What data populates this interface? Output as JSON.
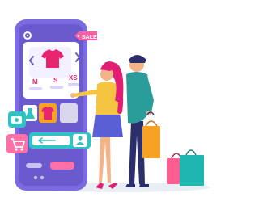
{
  "illustration": {
    "sale_tag_text": "SALE",
    "sizes": [
      "M",
      "S",
      "XS"
    ],
    "selected_size": "S",
    "colors": {
      "phone_body": "#6a5acd",
      "phone_screen": "#ffffff",
      "sale_tag": "#ff5fa2",
      "shirt": "#e8256f",
      "size_text": "#e8256f",
      "nav_arrows": "#6a5acd",
      "button_teal": "#2ec4c4",
      "button_pink": "#ff6fa8",
      "woman_hair": "#e11d74",
      "woman_top": "#f5c542",
      "woman_skirt": "#5b5fd6",
      "man_shirt": "#2a9d9a",
      "man_pants": "#2b2f6b",
      "bag_orange": "#f6a323",
      "bag_pink": "#ff5d8f",
      "bag_teal": "#1fb5b0"
    },
    "icons": [
      "gear-icon",
      "arrow-left-icon",
      "arrow-right-icon",
      "user-icon",
      "cart-icon",
      "dress-icon",
      "shirt-icon"
    ]
  }
}
